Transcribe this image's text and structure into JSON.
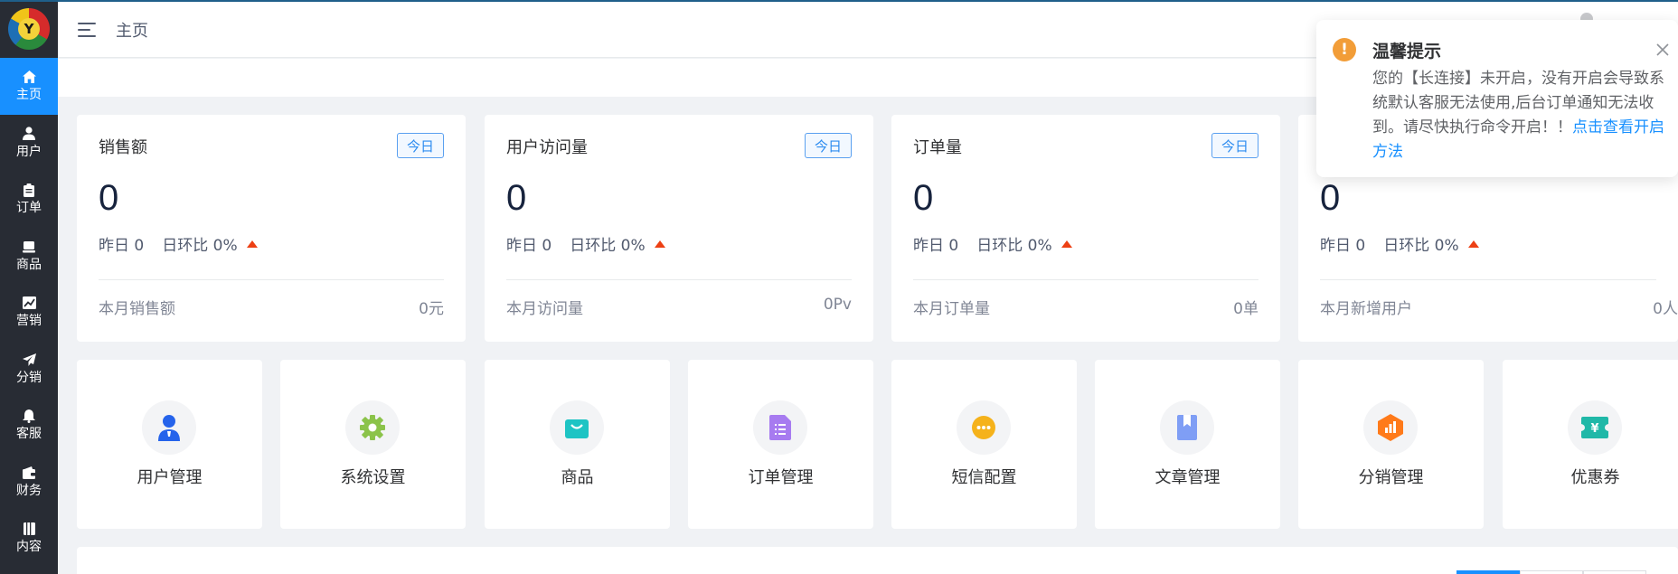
{
  "header": {
    "breadcrumb": "主页"
  },
  "sidebar": {
    "logo_letter": "Y",
    "items": [
      {
        "label": "主页",
        "icon": "home-icon",
        "active": true
      },
      {
        "label": "用户",
        "icon": "user-icon"
      },
      {
        "label": "订单",
        "icon": "clipboard-icon"
      },
      {
        "label": "商品",
        "icon": "product-icon"
      },
      {
        "label": "营销",
        "icon": "chart-icon"
      },
      {
        "label": "分销",
        "icon": "paper-plane-icon"
      },
      {
        "label": "客服",
        "icon": "bell-icon"
      },
      {
        "label": "财务",
        "icon": "wallet-icon"
      },
      {
        "label": "内容",
        "icon": "book-icon"
      }
    ]
  },
  "stats": [
    {
      "title": "销售额",
      "tag": "今日",
      "value": "0",
      "yesterday": "昨日 0",
      "ratio": "日环比 0%",
      "month_label": "本月销售额",
      "month_value": "0元"
    },
    {
      "title": "用户访问量",
      "tag": "今日",
      "value": "0",
      "yesterday": "昨日 0",
      "ratio": "日环比 0%",
      "month_label": "本月访问量",
      "month_value": "0Pv"
    },
    {
      "title": "订单量",
      "tag": "今日",
      "value": "0",
      "yesterday": "昨日 0",
      "ratio": "日环比 0%",
      "month_label": "本月订单量",
      "month_value": "0单"
    },
    {
      "title": "",
      "tag": "",
      "value": "0",
      "yesterday": "昨日 0",
      "ratio": "日环比 0%",
      "month_label": "本月新增用户",
      "month_value": "0人"
    }
  ],
  "quick": [
    {
      "label": "用户管理",
      "icon": "user-manage-icon",
      "color": "#2563eb"
    },
    {
      "label": "系统设置",
      "icon": "settings-gear-icon",
      "color": "#8bc34a"
    },
    {
      "label": "商品",
      "icon": "shopping-bag-icon",
      "color": "#1ec4c4"
    },
    {
      "label": "订单管理",
      "icon": "document-icon",
      "color": "#a77bf0"
    },
    {
      "label": "短信配置",
      "icon": "message-icon",
      "color": "#f5b21b"
    },
    {
      "label": "文章管理",
      "icon": "bookmark-icon",
      "color": "#7f9ef5"
    },
    {
      "label": "分销管理",
      "icon": "hexagon-chart-icon",
      "color": "#ff7a1a"
    },
    {
      "label": "优惠券",
      "icon": "coupon-icon",
      "color": "#20b8a8"
    }
  ],
  "notice": {
    "title": "温馨提示",
    "text": "您的【长连接】未开启，没有开启会导致系统默认客服无法使用,后台订单通知无法收到。请尽快执行命令开启！！",
    "link": "点击查看开启方法"
  }
}
